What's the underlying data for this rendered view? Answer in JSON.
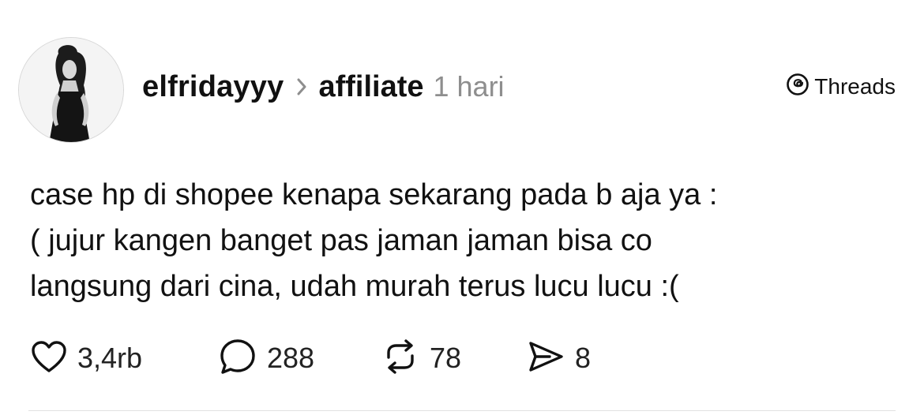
{
  "post": {
    "username": "elfridayyy",
    "community": "affiliate",
    "time": "1 hari",
    "text": "case hp di shopee kenapa sekarang pada b aja ya :\n( jujur kangen banget pas jaman jaman bisa co\nlangsung dari cina, udah murah terus lucu lucu :(",
    "avatar_icon": "profile-photo"
  },
  "brand": {
    "label": "Threads",
    "icon": "threads-logo-icon"
  },
  "actions": {
    "likes": "3,4rb",
    "replies": "288",
    "reposts": "78",
    "shares": "8"
  },
  "colors": {
    "text": "#111111",
    "muted": "#8e8e8e",
    "divider": "#e2e2e2",
    "background": "#ffffff"
  }
}
